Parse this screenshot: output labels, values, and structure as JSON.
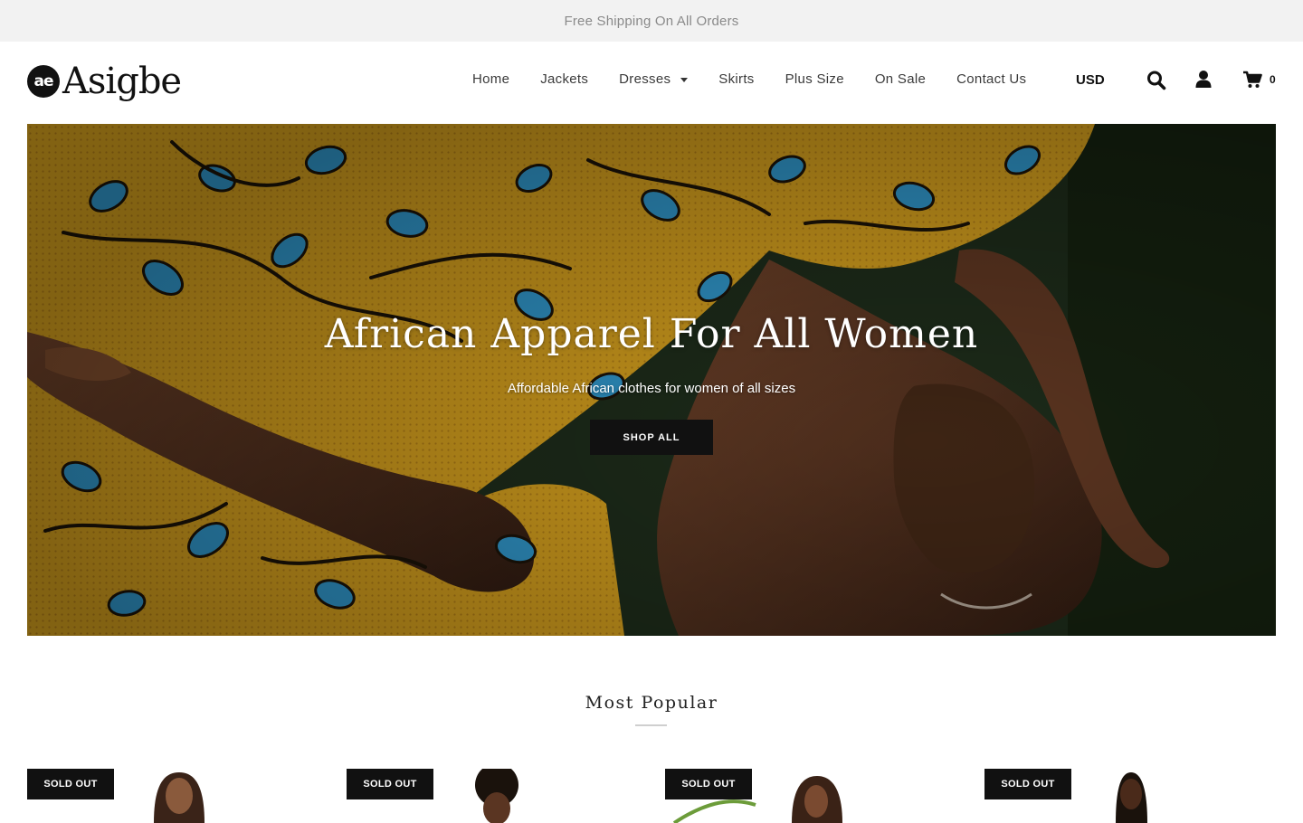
{
  "announcement": "Free Shipping On All Orders",
  "logo": {
    "mark": "ae",
    "word": "Asigbe"
  },
  "nav": [
    {
      "label": "Home"
    },
    {
      "label": "Jackets"
    },
    {
      "label": "Dresses",
      "has_dropdown": true
    },
    {
      "label": "Skirts"
    },
    {
      "label": "Plus Size"
    },
    {
      "label": "On Sale"
    },
    {
      "label": "Contact Us"
    }
  ],
  "header": {
    "currency": "USD",
    "cart_count": "0",
    "icons": [
      "search-icon",
      "account-icon",
      "cart-icon",
      "chevron-down-icon"
    ]
  },
  "hero": {
    "title": "African Apparel For All Women",
    "subtitle": "Affordable African clothes for women of all sizes",
    "button": "SHOP ALL"
  },
  "popular": {
    "title": "Most Popular",
    "products": [
      {
        "badge": "SOLD OUT"
      },
      {
        "badge": "SOLD OUT"
      },
      {
        "badge": "SOLD OUT"
      },
      {
        "badge": "SOLD OUT"
      }
    ]
  },
  "colors": {
    "accent": "#111111",
    "announcement_bg": "#f2f2f2",
    "fabric_gold": "#c8961c",
    "fabric_blue": "#2e8fc0"
  }
}
